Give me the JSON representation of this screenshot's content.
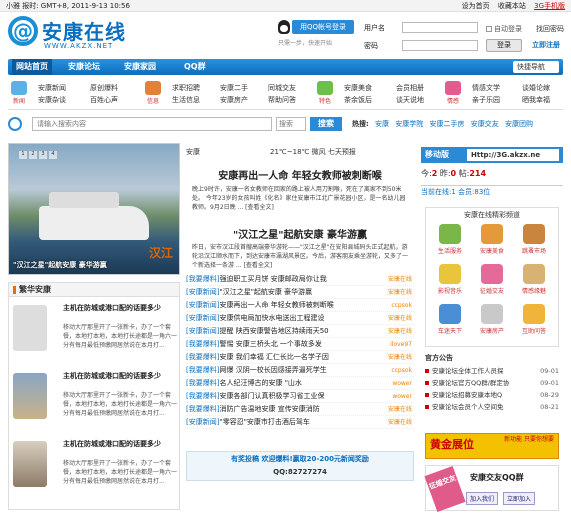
{
  "topbar": {
    "left": "小雅 报时: GMT+8, 2011-9-13 10:56",
    "links": [
      "设为首页",
      "收藏本站",
      "3G手机版"
    ]
  },
  "logo": {
    "at": "@",
    "name": "安康在线",
    "url": "WWW.AKZX.NET"
  },
  "qq_login": {
    "button": "用QQ帐号登录",
    "sub": "只需一步，快速开始"
  },
  "login": {
    "user_label": "用户名",
    "pass_label": "密码",
    "auto_login": "自动登录",
    "forgot": "找回密码",
    "submit": "登录",
    "register": "立即注册"
  },
  "nav": {
    "items": [
      "网站首页",
      "安康论坛",
      "安康家园",
      "QQ群"
    ],
    "guide": "快捷导航"
  },
  "subnav": {
    "groups": [
      {
        "icon": "新闻",
        "cols": [
          [
            "安康新闻",
            "安康杂谈"
          ],
          [
            "原创爆料",
            "百姓心声"
          ]
        ]
      },
      {
        "icon": "信息",
        "cols": [
          [
            "求职招聘",
            "生活信息"
          ],
          [
            "安康二手",
            "安康房产"
          ],
          [
            "同城交友",
            "帮助问答"
          ]
        ]
      },
      {
        "icon": "特色",
        "cols": [
          [
            "安康美食",
            "茶余饭后"
          ],
          [
            "会员相册",
            "谈天说地"
          ]
        ]
      },
      {
        "icon": "情感",
        "cols": [
          [
            "情感文学",
            "亲子乐园"
          ],
          [
            "谈婚论嫁",
            "晒我幸福"
          ]
        ]
      }
    ]
  },
  "search": {
    "placeholder": "请输入搜索内容",
    "select": "搜索",
    "button": "搜索",
    "hot_label": "热搜:",
    "hot": [
      "安康",
      "安康学院",
      "安康二手房",
      "安康交友",
      "安康团购"
    ]
  },
  "slider": {
    "caption": "\"汉江之星\"起航安康 豪华游赢",
    "flag": "汉江",
    "dots": [
      "1",
      "2",
      "3",
      "4"
    ]
  },
  "left_list": {
    "title": "繁华安康",
    "items": [
      {
        "title": "主机在防城或港口配的话要多少",
        "desc": "移动大厅那里开了一张新卡，办了一个套餐，本地打本地，本地打长途都是一角六一分有每月最低预缴网居然说在本月打..."
      },
      {
        "title": "主机在防城或港口配的话要多少",
        "desc": "移动大厅那里开了一张新卡，办了一个套餐，本地打本地，本地打长途都是一角六一分有每月最低预缴网居然说在本月打..."
      },
      {
        "title": "主机在防城或港口配的话要多少",
        "desc": "移动大厅那里开了一张新卡，办了一个套餐，本地打本地，本地打长途都是一角六一分有每月最低预缴网居然说在本月打..."
      }
    ]
  },
  "center": {
    "tabs": "安康",
    "weather": "21℃~18℃  微风  七天预报",
    "headline1": "安康再出一人命 年轻女教师被刺断喉",
    "para1": "晚上9时许，安康一名女教师在回家的路上被人用刀割喉，死在了离家不到50米处。  今年23岁的女孩叫姓《化名》家住安康市江北广景花园小区，是一名幼儿园教师。9月2日晚 ... [查看全文]",
    "headline2": "\"汉江之星\"起航安康 豪华游赢",
    "para2": "昨日，安市汉江段首艘高端豪华游轮——\"汉江之星\"在安阳县城码头正式起航，游轮沿汉江顺水而下，到达安康市瀛湖风景区。今后，游客朋友乘坐游轮，又多了一个新选择一条游 ... [查看全文]",
    "news": [
      {
        "cat": "[我要爆料]",
        "title": "强迫职工买月饼 安康邮政局你让我",
        "src": "安康在线"
      },
      {
        "cat": "[安康新闻]",
        "title": "\"汉江之星\"起航安康 豪华游赢",
        "src": "安康在线"
      },
      {
        "cat": "[安康新闻]",
        "title": "安康再出一人命 年轻女教师被刺断喉",
        "src": "ccpsok"
      },
      {
        "cat": "[安康新闻]",
        "title": "安康供电局加快水电送出工程建设",
        "src": "安康在线"
      },
      {
        "cat": "[安康新闻]",
        "title": "提醒 陕西安康警告地区持续雨天50",
        "src": "安康在线"
      },
      {
        "cat": "[我要爆料]",
        "title": "警惕 安康三桥头北 一个事故多发",
        "src": "ilove97"
      },
      {
        "cat": "[我要爆料]",
        "title": "安康 我们幸福 汇仁长比一名学子因",
        "src": "安康在线"
      },
      {
        "cat": "[我要爆料]",
        "title": "网爆 汉阴一校长因感接弄逼死学生",
        "src": "ccpsok"
      },
      {
        "cat": "[我要爆料]",
        "title": "名人纪汪博古的安康 \"山水",
        "src": "wower"
      },
      {
        "cat": "[我要爆料]",
        "title": "安康各部门认真积极学习省工业保",
        "src": "wower"
      },
      {
        "cat": "[我要爆料]",
        "title": "消防广告温地安康 宣传安康消防",
        "src": "安康在线"
      },
      {
        "cat": "[安康新闻]",
        "title": "\"零容忍\"安康市打击酒后驾车",
        "src": "安康在线"
      }
    ],
    "foot1": "有奖投稿 欢迎爆料!赢取20-200元新闻奖励",
    "foot2": "QQ:82727274"
  },
  "right": {
    "mobile_label": "移动版",
    "mobile_url": "Http://3G.akzx.ne",
    "stats_line": "今:2  昨:0  帖:214",
    "stats_sub": "当前在线:1 会员:83位",
    "channel_title": "安康在线精彩频道",
    "channels": [
      "生活服务",
      "安康美食",
      "跳蚤市场",
      "影视音乐",
      "征婚交友",
      "情感缘魅",
      "车迷天下",
      "安康房产",
      "互助问答"
    ],
    "official_title": "官方公告",
    "official": [
      {
        "t": "安康论坛全体工作人员探",
        "d": "09-01"
      },
      {
        "t": "安康论坛官方QQ群/群定协",
        "d": "09-01"
      },
      {
        "t": "安康论坛招募安康本地Q",
        "d": "08-29"
      },
      {
        "t": "安康论坛会员个人空间免",
        "d": "08-21"
      }
    ],
    "banner_big": "黄金展位",
    "banner_small": "新功能\n只要你想要",
    "qq_badge": "征婚交友",
    "qq_title": "安康交友QQ群",
    "qq_btns": [
      "加入我们",
      "立即加入"
    ]
  }
}
